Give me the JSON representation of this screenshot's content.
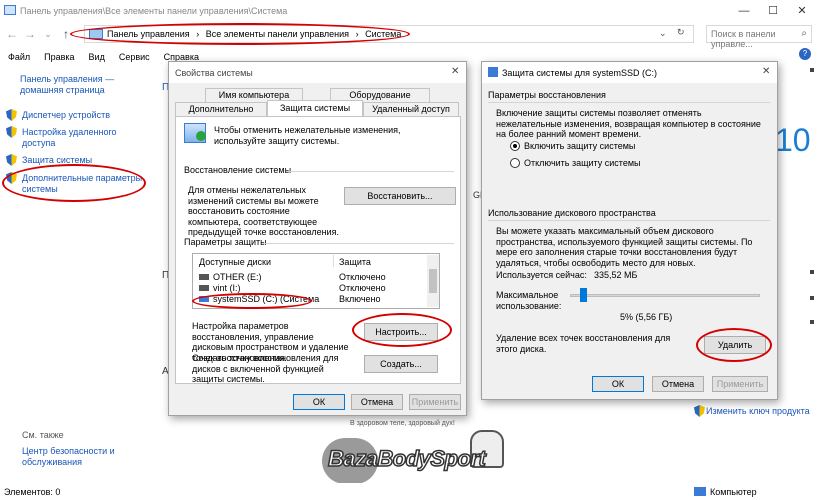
{
  "window": {
    "title": "Панель управления\\Все элементы панели управления\\Система",
    "min": "—",
    "max": "☐",
    "close": "✕"
  },
  "nav": {
    "back": "←",
    "forward": "→",
    "down": "⌄",
    "up": "↑",
    "breadcrumbs": [
      "Панель управления",
      "›",
      "Все элементы панели управления",
      "›",
      "Система"
    ],
    "addr_down": "⌄",
    "refresh": "↻",
    "search_placeholder": "Поиск в панели управле..."
  },
  "menu": [
    "Файл",
    "Правка",
    "Вид",
    "Сервис",
    "Справка"
  ],
  "sidebar": {
    "home": "Панель управления — домашняя страница",
    "items": [
      "Диспетчер устройств",
      "Настройка удаленного доступа",
      "Защита системы",
      "Дополнительные параметры системы"
    ],
    "see_also": "См. также",
    "security": "Центр безопасности и обслуживания"
  },
  "background": {
    "big_number": "10",
    "letter_p": "П",
    "letter_a": "А",
    "gh": "GH",
    "change_key": "Изменить ключ продукта"
  },
  "sysprops": {
    "title": "Свойства системы",
    "close": "✕",
    "tabs_top": [
      "Имя компьютера",
      "Оборудование"
    ],
    "tabs_bottom": [
      "Дополнительно",
      "Защита системы",
      "Удаленный доступ"
    ],
    "intro": "Чтобы отменить нежелательные изменения, используйте защиту системы.",
    "restore_header": "Восстановление системы",
    "restore_text": "Для отмены нежелательных изменений системы вы можете восстановить состояние компьютера, соответствующее предыдущей точке восстановления.",
    "restore_btn": "Восстановить...",
    "protect_header": "Параметры защиты",
    "col_disks": "Доступные диски",
    "col_protect": "Защита",
    "rows": [
      {
        "disk": "OTHER (E:)",
        "state": "Отключено"
      },
      {
        "disk": "vint (I:)",
        "state": "Отключено"
      },
      {
        "disk": "systemSSD (C:) (Система",
        "state": "Включено"
      }
    ],
    "configure_text": "Настройка параметров восстановления, управление дисковым пространством и удаление точек восстановления.",
    "configure_btn": "Настроить...",
    "create_text": "Создать точку восстановления для дисков с включенной функцией защиты системы.",
    "create_btn": "Создать...",
    "ok": "ОК",
    "cancel": "Отмена",
    "apply": "Применить"
  },
  "protect": {
    "title": "Защита системы для systemSSD (C:)",
    "close": "✕",
    "recovery_header": "Параметры восстановления",
    "recovery_text": "Включение защиты системы позволяет отменять нежелательные изменения, возвращая компьютер в состояние на более ранний момент времени.",
    "enable": "Включить защиту системы",
    "disable": "Отключить защиту системы",
    "disk_header": "Использование дискового пространства",
    "disk_text": "Вы можете указать максимальный объем дискового пространства, используемого функцией защиты системы. По мере его заполнения старые точки восстановления будут удаляться, чтобы освободить место для новых.",
    "used_label": "Используется сейчас:",
    "used_value": "335,52 МБ",
    "max_label": "Максимальное использование:",
    "slider_value": "5% (5,56 ГБ)",
    "slider_fraction": 0.05,
    "delete_text": "Удаление всех точек восстановления для этого диска.",
    "delete_btn": "Удалить",
    "ok": "ОК",
    "cancel": "Отмена",
    "apply": "Применить"
  },
  "watermark": {
    "tagline": "В здоровом теле, здоровый дух!",
    "logo": "BazaBodySport"
  },
  "status": {
    "elements": "Элементов: 0",
    "computer": "Компьютер"
  }
}
